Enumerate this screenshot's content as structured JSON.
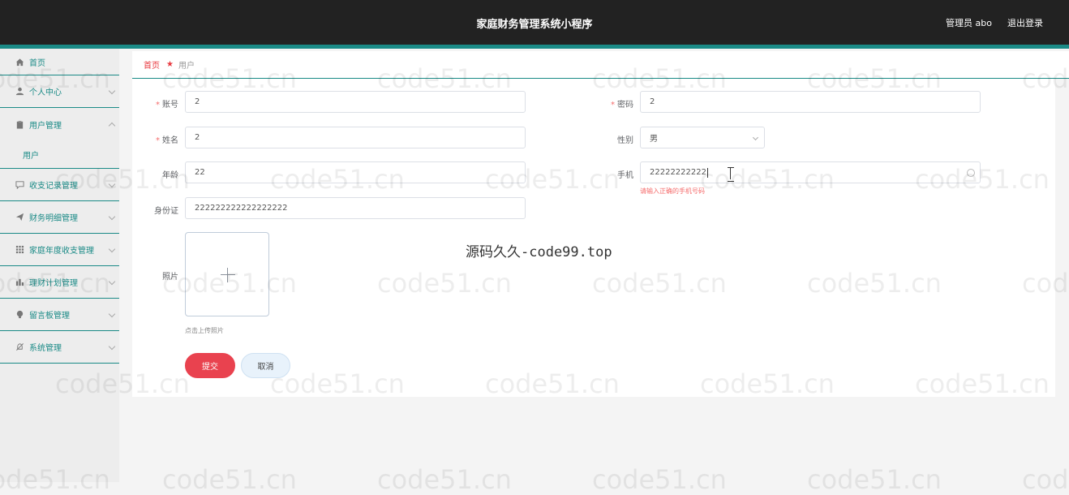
{
  "header": {
    "title": "家庭财务管理系统小程序",
    "admin_label": "管理员 abo",
    "logout_label": "退出登录"
  },
  "sidebar": {
    "items": [
      {
        "label": "首页",
        "icon": "home-icon"
      },
      {
        "label": "个人中心",
        "icon": "user-icon"
      },
      {
        "label": "用户管理",
        "icon": "clipboard-icon"
      },
      {
        "label": "用户",
        "icon": ""
      },
      {
        "label": "收支记录管理",
        "icon": "chat-icon"
      },
      {
        "label": "财务明细管理",
        "icon": "send-icon"
      },
      {
        "label": "家庭年度收支管理",
        "icon": "grid-icon"
      },
      {
        "label": "理财计划管理",
        "icon": "bar-chart-icon"
      },
      {
        "label": "留言板管理",
        "icon": "bulb-icon"
      },
      {
        "label": "系统管理",
        "icon": "bell-off-icon"
      }
    ]
  },
  "breadcrumb": {
    "home": "首页",
    "current": "用户"
  },
  "form": {
    "account_label": "账号",
    "account_value": "2",
    "password_label": "密码",
    "password_value": "2",
    "name_label": "姓名",
    "name_value": "2",
    "gender_label": "性别",
    "gender_value": "男",
    "age_label": "年龄",
    "age_value": "22",
    "phone_label": "手机",
    "phone_value": "22222222222",
    "phone_error": "请输入正确的手机号码",
    "idcard_label": "身份证",
    "idcard_value": "222222222222222222",
    "photo_label": "照片",
    "photo_hint": "点击上传照片",
    "submit_label": "提交",
    "cancel_label": "取消"
  },
  "overlay": {
    "promo": "源码久久-code99.top",
    "watermark": "code51.cn"
  },
  "colors": {
    "accent": "#1a8a86",
    "danger": "#e9424f",
    "topbar": "#222222"
  }
}
